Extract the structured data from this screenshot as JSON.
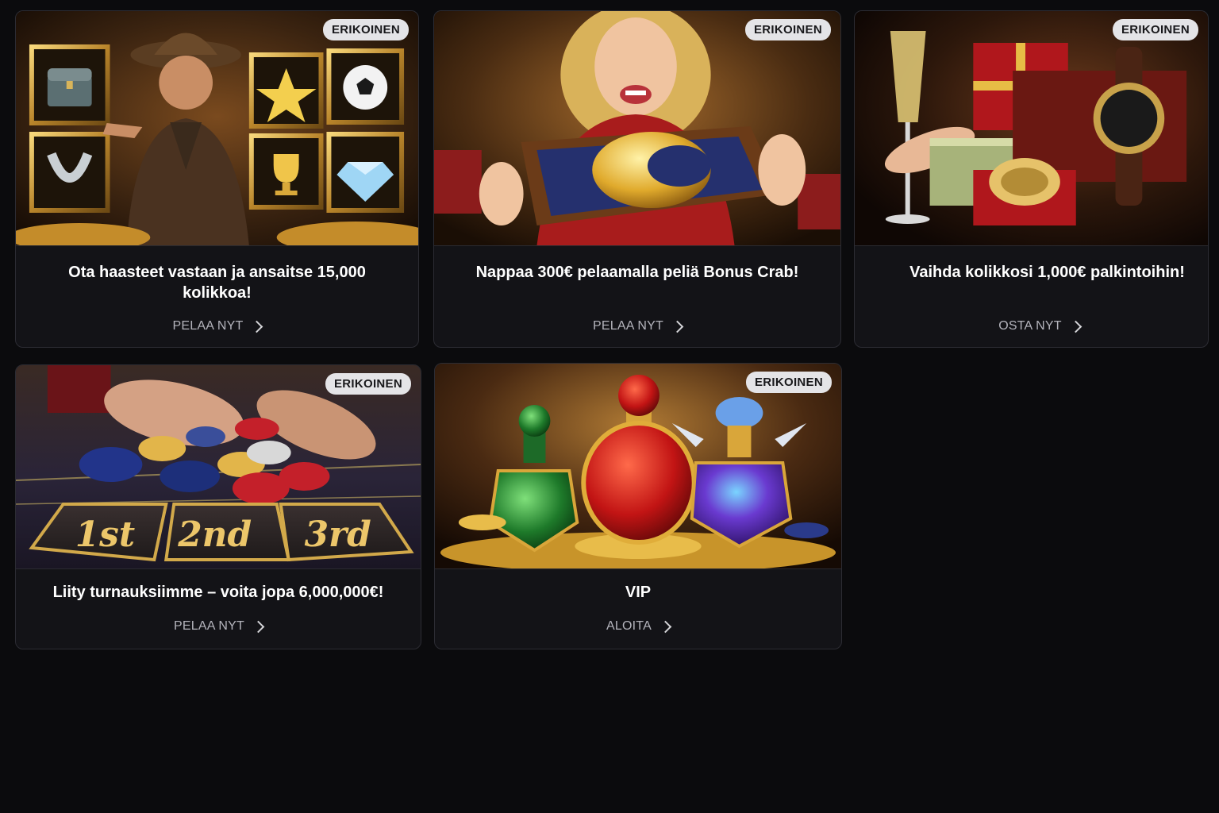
{
  "cards": [
    {
      "badge": "ERIKOINEN",
      "title": "Ota haasteet vastaan ja ansaitse 15,000 kolikkoa!",
      "cta": "PELAA NYT",
      "image": "adventurer-slot-symbols"
    },
    {
      "badge": "ERIKOINEN",
      "title": "Nappaa 300€ pelaamalla peliä Bonus Crab!",
      "cta": "PELAA NYT",
      "image": "woman-with-golden-coin-box"
    },
    {
      "badge": "ERIKOINEN",
      "title": "Vaihda kolikkosi 1,000€ palkintoihin!",
      "cta": "OSTA NYT",
      "image": "champagne-gifts-watch"
    },
    {
      "badge": "ERIKOINEN",
      "title": "Liity turnauksiimme – voita jopa 6,000,000€!",
      "cta": "PELAA NYT",
      "image": "casino-chips-podium",
      "podium": [
        "1st",
        "2nd",
        "3rd"
      ]
    },
    {
      "badge": "ERIKOINEN",
      "title": "VIP",
      "cta": "ALOITA",
      "image": "vip-potion-bottles"
    }
  ],
  "colors": {
    "background": "#0b0b0d",
    "card": "#131317",
    "badge": "#e4e4e7",
    "cta_text": "#b4b4bc"
  }
}
